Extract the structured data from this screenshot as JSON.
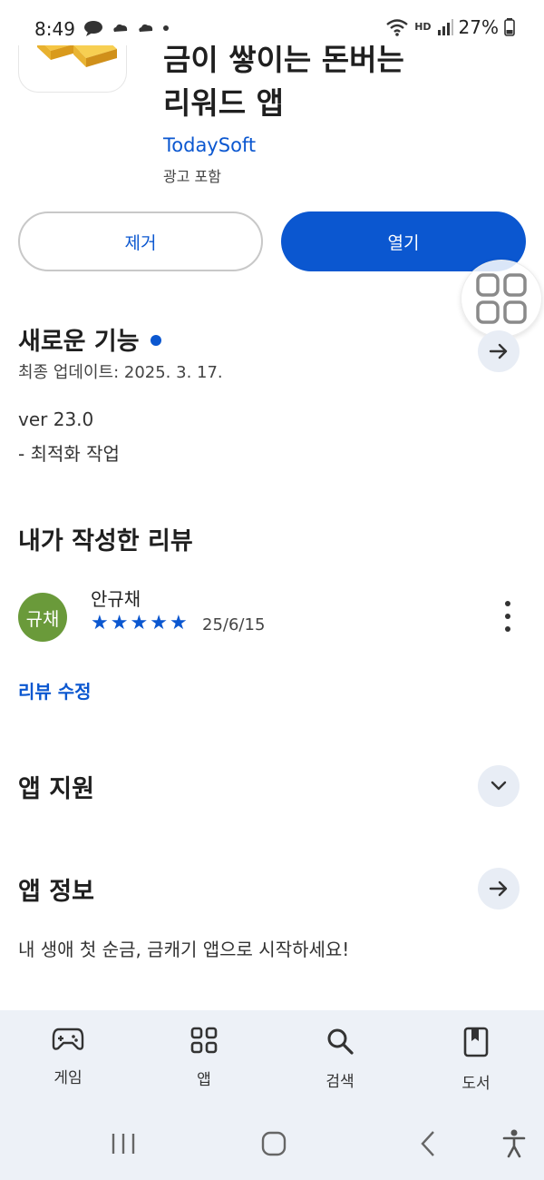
{
  "status_bar": {
    "time": "8:49",
    "network_label": "HD",
    "battery_text": "27%"
  },
  "app": {
    "title_line1": "금이 쌓이는 돈버는",
    "title_line2": "리워드 앱",
    "developer": "TodaySoft",
    "ads_label": "광고 포함"
  },
  "actions": {
    "uninstall_label": "제거",
    "open_label": "열기"
  },
  "whats_new": {
    "title": "새로운 기능",
    "updated": "최종 업데이트: 2025. 3. 17.",
    "version": "ver 23.0",
    "notes": "- 최적화 작업"
  },
  "my_review": {
    "title": "내가 작성한 리뷰",
    "avatar_text": "규채",
    "reviewer": "안규채",
    "rating": 5,
    "date": "25/6/15",
    "edit_label": "리뷰 수정"
  },
  "app_support": {
    "title": "앱 지원"
  },
  "about": {
    "title": "앱 정보",
    "description": "내 생애 첫 순금, 금캐기 앱으로 시작하세요!"
  },
  "bottom_nav": {
    "items": [
      {
        "label": "게임",
        "icon": "gamepad-icon"
      },
      {
        "label": "앱",
        "icon": "apps-grid-icon"
      },
      {
        "label": "검색",
        "icon": "search-icon"
      },
      {
        "label": "도서",
        "icon": "book-icon"
      }
    ]
  },
  "colors": {
    "accent": "#0b57d0",
    "avatar": "#6a9a3a",
    "nav_bg": "#edf1f7"
  }
}
